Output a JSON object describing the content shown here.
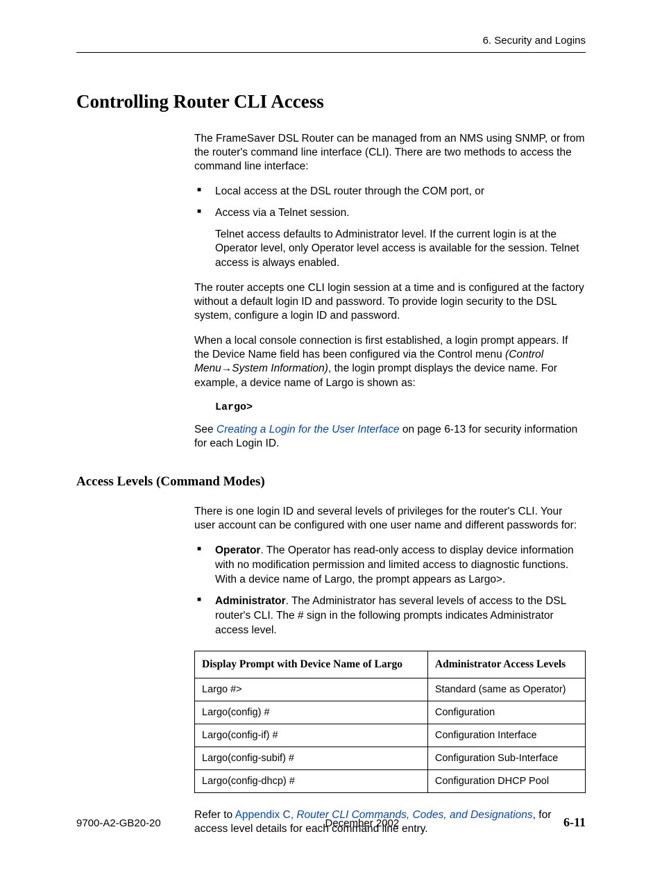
{
  "header": {
    "chapter": "6. Security and Logins"
  },
  "h1": "Controlling Router CLI Access",
  "intro_p1": "The FrameSaver DSL Router can be managed from an NMS using SNMP, or from the router's command line interface (CLI). There are two methods to access the command line interface:",
  "bullets1": {
    "b1": "Local access at the DSL router through the COM port, or",
    "b2": "Access via a Telnet session.",
    "b2_sub": "Telnet access defaults to Administrator level. If the current login is at the Operator level, only Operator level access is available for the session. Telnet access is always enabled."
  },
  "p2": "The router accepts one CLI login session at a time and is configured at the factory without a default login ID and password. To provide login security to the DSL system, configure a login ID and password.",
  "p3_a": "When a local console connection is first established, a login prompt appears. If the Device Name field has been configured via the Control menu ",
  "p3_menu_a": "(Control Menu",
  "p3_menu_b": "System Information)",
  "p3_b": ", the login prompt displays the device name. For example, a device name of Largo is shown as:",
  "code1": "Largo>",
  "p4_a": "See ",
  "p4_link": "Creating a Login for the User Interface",
  "p4_b": " on page 6-13 for security information for each Login ID.",
  "h2": "Access Levels (Command Modes)",
  "p5": "There is one login ID and several levels of privileges for the router's CLI. Your user account can be configured with one user name and different passwords for:",
  "bullets2": {
    "op_bold": "Operator",
    "op_text": ". The Operator has read-only access to display device information with no modification permission and limited access to diagnostic functions. With a device name of Largo, the prompt appears as Largo>.",
    "ad_bold": "Administrator",
    "ad_text": ". The Administrator has several levels of access to the DSL router's CLI. The # sign in the following prompts indicates Administrator access level."
  },
  "table": {
    "h1": "Display Prompt with Device Name of Largo",
    "h2": "Administrator Access Levels",
    "rows": [
      {
        "c1": "Largo #>",
        "c2": "Standard (same as Operator)"
      },
      {
        "c1": "Largo(config) #",
        "c2": "Configuration"
      },
      {
        "c1": "Largo(config-if) #",
        "c2": "Configuration Interface"
      },
      {
        "c1": "Largo(config-subif) #",
        "c2": "Configuration Sub-Interface"
      },
      {
        "c1": "Largo(config-dhcp) #",
        "c2": "Configuration DHCP Pool"
      }
    ]
  },
  "p6_a": "Refer to ",
  "p6_link1": "Appendix C, ",
  "p6_link2": "Router CLI Commands, Codes, and Designations",
  "p6_b": ", for access level details for each command line entry.",
  "footer": {
    "doc": "9700-A2-GB20-20",
    "date": "December 2002",
    "page": "6-11"
  }
}
